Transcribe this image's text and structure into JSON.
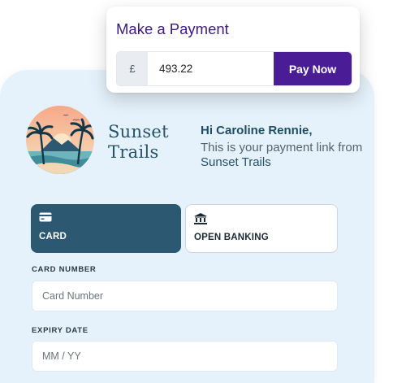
{
  "payment_widget": {
    "title": "Make a Payment",
    "currency_symbol": "£",
    "amount_value": "493.22",
    "pay_button_label": "Pay Now",
    "accent_color": "#4a1d97"
  },
  "merchant": {
    "brand_line1": "Sunset",
    "brand_line2": "Trails",
    "logo_icon": "sunset-palm-island-logo"
  },
  "greeting": {
    "hello": "Hi Caroline Rennie,",
    "message_prefix": "This is your payment link from",
    "message_brand": "Sunset Trails"
  },
  "payment_methods": [
    {
      "label": "CARD",
      "icon": "card-icon",
      "selected": true
    },
    {
      "label": "OPEN BANKING",
      "icon": "bank-icon",
      "selected": false
    }
  ],
  "form": {
    "card_number_label": "CARD NUMBER",
    "card_number_placeholder": "Card Number",
    "expiry_label": "EXPIRY DATE",
    "expiry_placeholder": "MM / YY"
  },
  "colors": {
    "panel_bg": "#e6f2fb",
    "brand_teal": "#2c5871"
  }
}
